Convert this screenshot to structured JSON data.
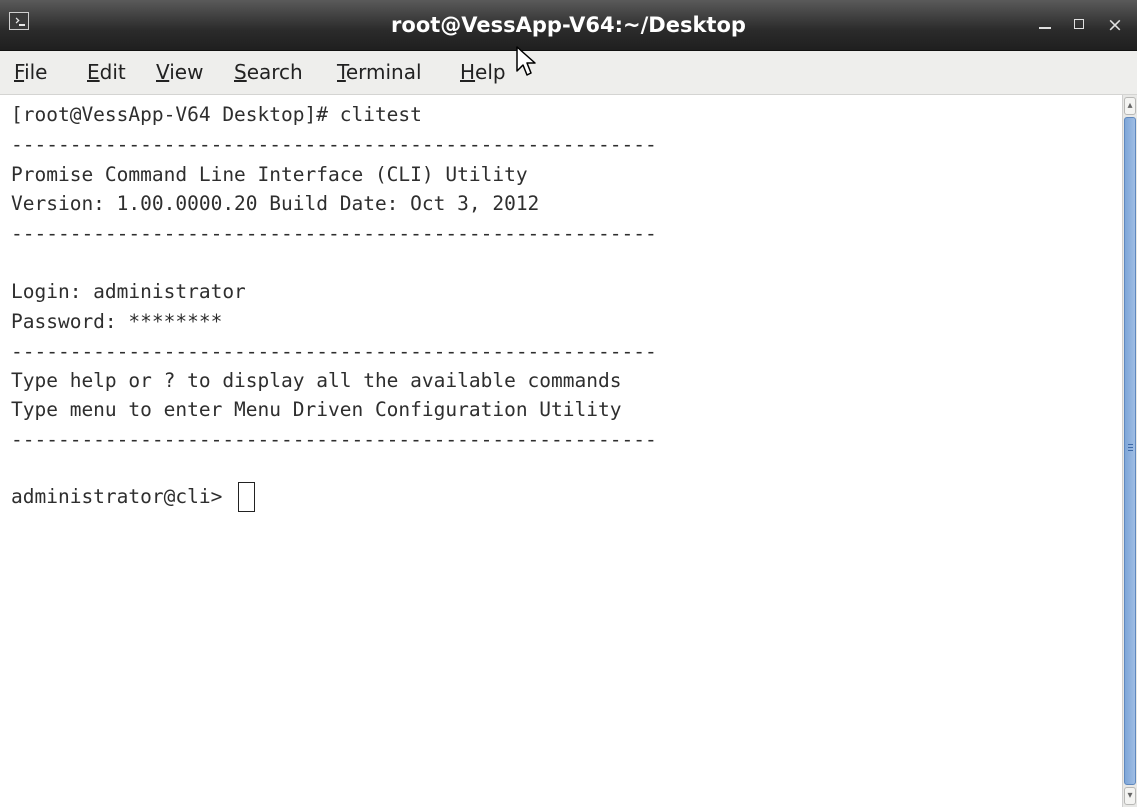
{
  "window": {
    "title": "root@VessApp-V64:~/Desktop",
    "controls": {
      "minimize": "minimize",
      "maximize": "maximize",
      "close": "×"
    }
  },
  "menu": {
    "items": [
      {
        "mnemonic": "F",
        "rest": "ile"
      },
      {
        "mnemonic": "E",
        "rest": "dit"
      },
      {
        "mnemonic": "V",
        "rest": "iew"
      },
      {
        "mnemonic": "S",
        "rest": "earch"
      },
      {
        "mnemonic": "T",
        "rest": "erminal"
      },
      {
        "mnemonic": "H",
        "rest": "elp"
      }
    ]
  },
  "terminal": {
    "lines": [
      "[root@VessApp-V64 Desktop]# clitest",
      "-------------------------------------------------------",
      "Promise Command Line Interface (CLI) Utility",
      "Version: 1.00.0000.20 Build Date: Oct 3, 2012",
      "-------------------------------------------------------",
      "",
      "Login: administrator",
      "Password: ********",
      "-------------------------------------------------------",
      "Type help or ? to display all the available commands",
      "Type menu to enter Menu Driven Configuration Utility",
      "-------------------------------------------------------",
      "",
      "administrator@cli> "
    ]
  },
  "icons": {
    "window_icon": "terminal-icon",
    "scroll_up": "chevron-up-icon",
    "scroll_down": "chevron-down-icon",
    "pointer": "mouse-pointer-icon"
  },
  "colors": {
    "titlebar": "#2b2b2b",
    "menubar": "#eeeeec",
    "terminal_bg": "#ffffff",
    "terminal_fg": "#2e2e2e",
    "scroll_thumb": "#8fb1de"
  }
}
